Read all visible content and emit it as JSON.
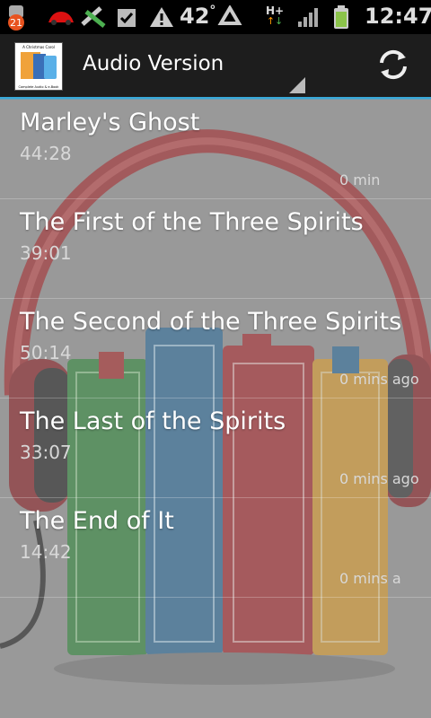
{
  "status_bar": {
    "notification_badge": "21",
    "temperature": "42",
    "degree_mark": "°",
    "network_type": "H+",
    "time": "12:47"
  },
  "action_bar": {
    "title": "Audio Version",
    "app_icon_text_top": "A Christmas Carol",
    "app_icon_text_bottom": "Complete Audio & e-Book"
  },
  "tracks": [
    {
      "title": "Marley's Ghost",
      "duration": "44:28",
      "ago": "0 min"
    },
    {
      "title": "The First of the Three Spirits",
      "duration": "39:01",
      "ago": ""
    },
    {
      "title": "The Second of the Three Spirits",
      "duration": "50:14",
      "ago": "0 mins ago"
    },
    {
      "title": "The Last of the Spirits",
      "duration": "33:07",
      "ago": "0 mins ago"
    },
    {
      "title": "The End of It",
      "duration": "14:42",
      "ago": "0 mins a"
    }
  ],
  "colors": {
    "accent": "#38a8d8",
    "actionbar_bg": "#1d1d1d",
    "list_bg": "#9a9a9a"
  },
  "icons": [
    "notification-icon",
    "cars-icon",
    "sync-arrows-icon",
    "task-check-icon",
    "warning-icon",
    "recycle-icon",
    "signal-icon",
    "battery-icon",
    "refresh-icon"
  ]
}
